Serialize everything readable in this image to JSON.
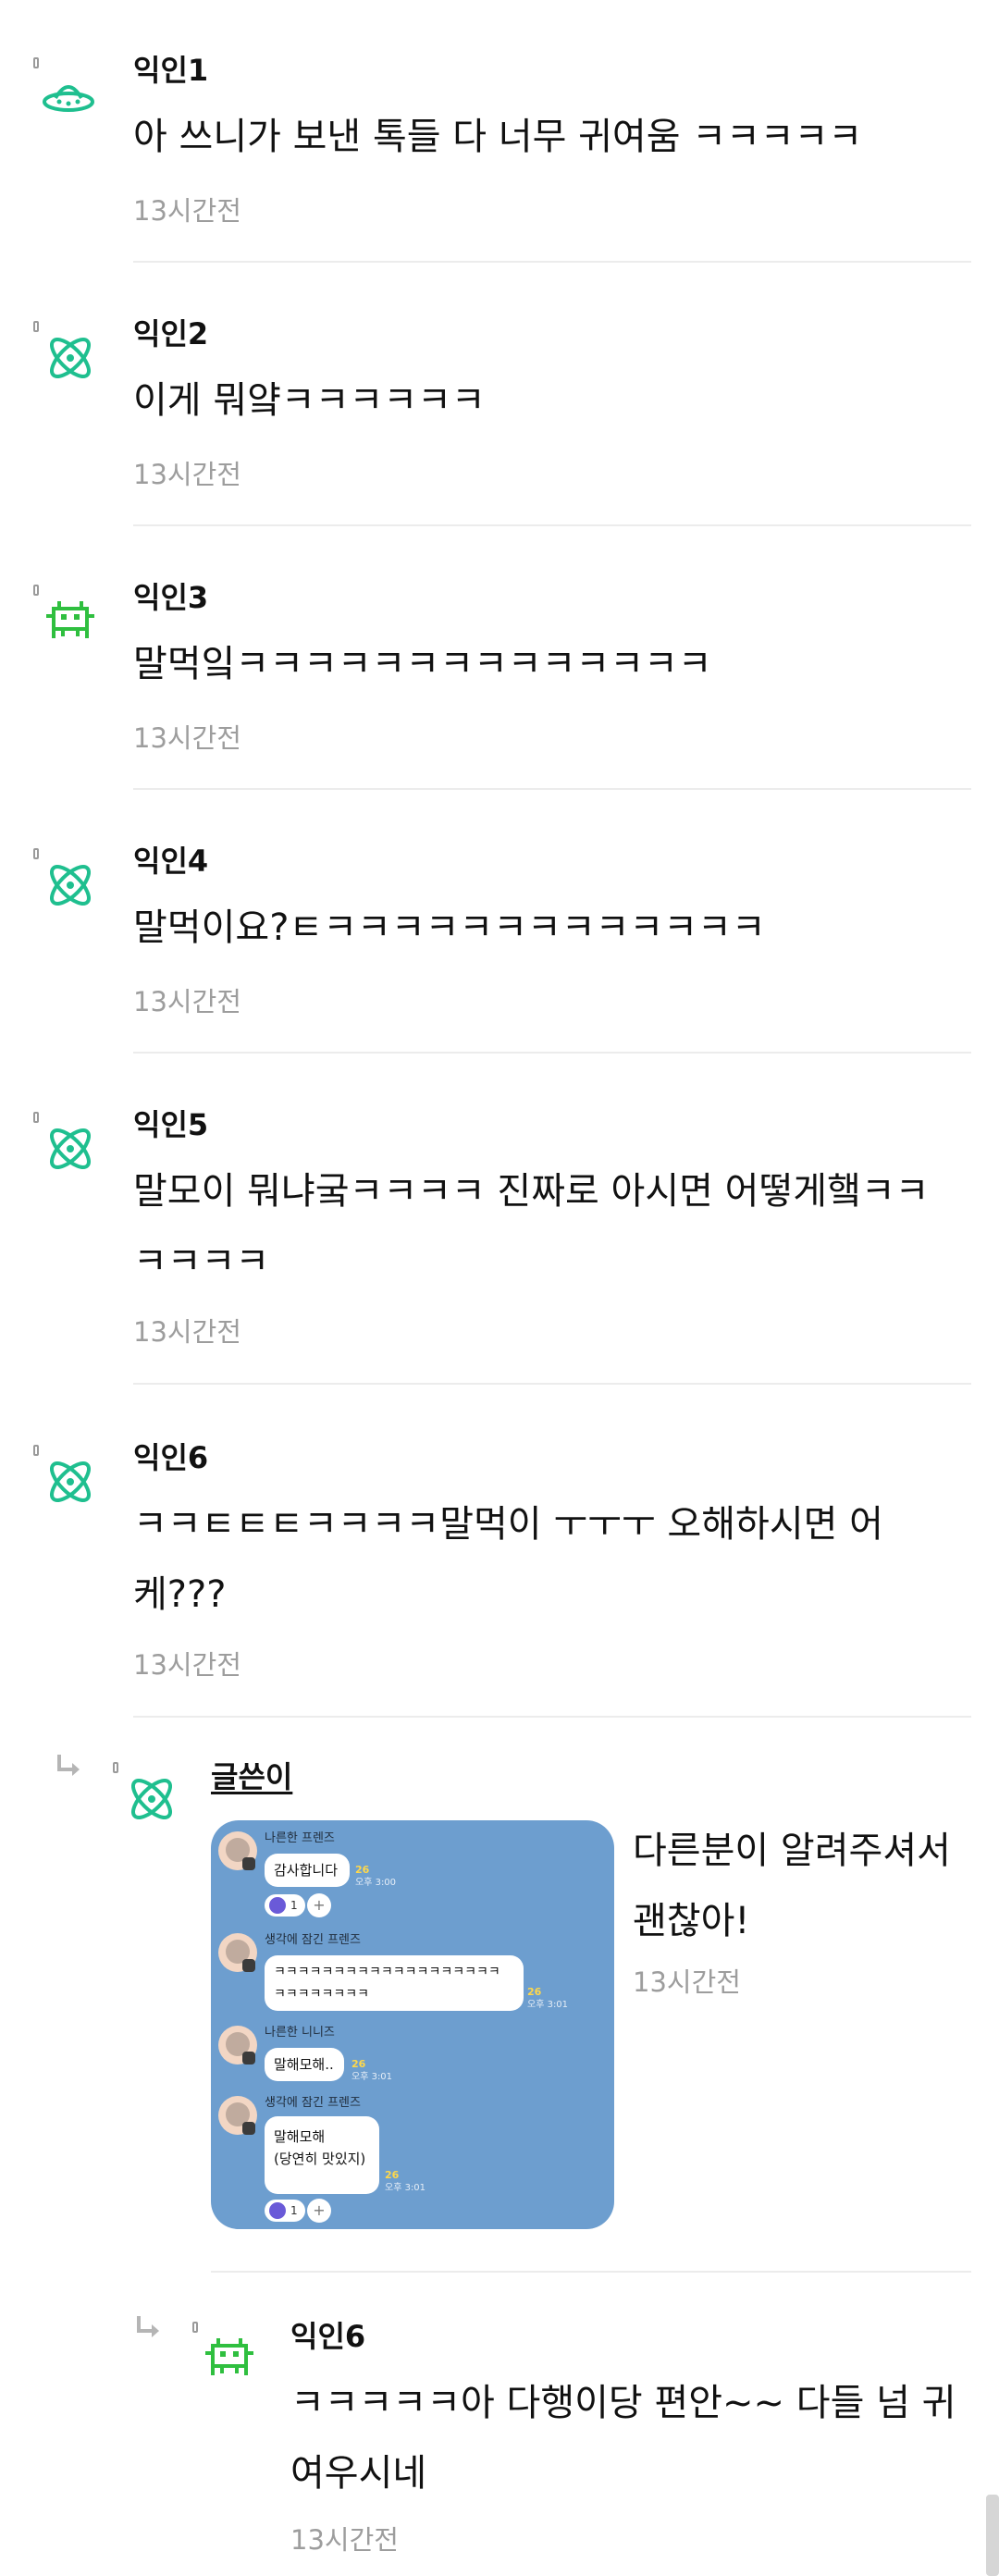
{
  "comments": [
    {
      "author": "익인1",
      "avatar_icon": "ufo-icon",
      "text_lines": [
        "아 쓰니가 보낸 톡들 다 너무 귀여움 ㅋㅋㅋㅋㅋ"
      ],
      "time": "13시간전"
    },
    {
      "author": "익인2",
      "avatar_icon": "atom-icon",
      "text_lines": [
        "이게 뭐얔ㅋㅋㅋㅋㅋㅋ"
      ],
      "time": "13시간전"
    },
    {
      "author": "익인3",
      "avatar_icon": "space-invader-icon",
      "text_lines": [
        "말먹잌ㅋㅋㅋㅋㅋㅋㅋㅋㅋㅋㅋㅋㅋㅋ"
      ],
      "time": "13시간전"
    },
    {
      "author": "익인4",
      "avatar_icon": "atom-icon",
      "text_lines": [
        "말먹이요?ㅌㅋㅋㅋㅋㅋㅋㅋㅋㅋㅋㅋㅋㅋ"
      ],
      "time": "13시간전"
    },
    {
      "author": "익인5",
      "avatar_icon": "atom-icon",
      "text_lines": [
        "말모이 뭐냐궄ㅋㅋㅋㅋ 진짜로 아시면 어떻게햌ㅋㅋ",
        "ㅋㅋㅋㅋ"
      ],
      "time": "13시간전"
    },
    {
      "author": "익인6",
      "avatar_icon": "atom-icon",
      "text_lines": [
        "ㅋㅋㅌㅌㅌㅋㅋㅋㅋ말먹이 ㅜㅜㅜ 오해하시면 어",
        "케???"
      ],
      "time": "13시간전"
    }
  ],
  "reply_op": {
    "author": "글쓴이",
    "avatar_icon": "atom-icon",
    "text_lines": [
      "다른분이 알려주셔서",
      "괜찮아!"
    ],
    "time": "13시간전",
    "image": {
      "messages": [
        {
          "sender": "나른한 프렌즈",
          "text": "감사합니다",
          "unread": "26",
          "time": "오후 3:00",
          "reaction_count": "1"
        },
        {
          "sender": "생각에 잠긴 프렌즈",
          "text": "ㅋㅋㅋㅋㅋㅋㅋㅋㅋㅋㅋㅋㅋㅋㅋㅋㅋㅋㅋ\nㅋㅋㅋㅋㅋㅋㅋㅋ",
          "unread": "26",
          "time": "오후 3:01"
        },
        {
          "sender": "나른한 니니즈",
          "text": "말해모해..",
          "unread": "26",
          "time": "오후 3:01"
        },
        {
          "sender": "생각에 잠긴 프렌즈",
          "text": "말해모해\n(당연히 맛있지)",
          "unread": "26",
          "time": "오후 3:01",
          "reaction_count": "1"
        }
      ]
    }
  },
  "reply_2": {
    "author": "익인6",
    "avatar_icon": "space-invader-icon",
    "text_lines": [
      "ㅋㅋㅋㅋㅋ아 다행이당 편안~~ 다들 넘 귀",
      "여우시네"
    ],
    "time": "13시간전"
  },
  "colors": {
    "icon_teal": "#1fbf8f",
    "icon_green": "#2fbf3f",
    "chat_bg": "#6d9ecf",
    "time_gray": "#9d9d9d"
  }
}
